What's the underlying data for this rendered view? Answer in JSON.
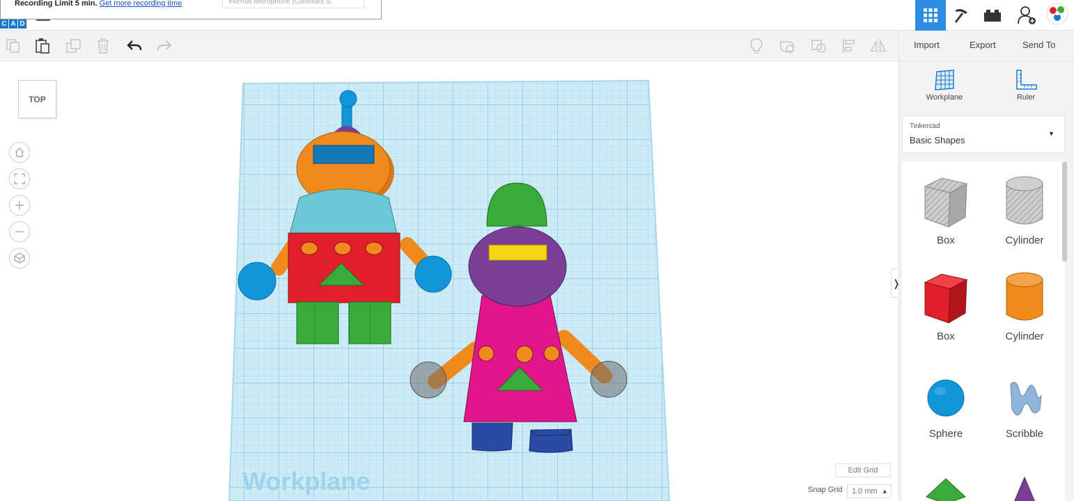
{
  "recording": {
    "limit_text": "Recording Limit 5 min.",
    "link_text": "Get more recording time",
    "mic_select": "Internal Microphone (Conexant S"
  },
  "header": {
    "logo_letters": [
      "C",
      "A",
      "D"
    ],
    "buttons": [
      {
        "name": "grid-view",
        "active": true
      },
      {
        "name": "pickaxe",
        "active": false
      },
      {
        "name": "bricks",
        "active": false
      },
      {
        "name": "add-user",
        "active": false
      },
      {
        "name": "avatar",
        "active": false
      }
    ]
  },
  "toolbar": {
    "actions": {
      "import": "Import",
      "export": "Export",
      "send_to": "Send To"
    }
  },
  "viewcube": {
    "label": "TOP"
  },
  "workplane": {
    "label": "Workplane",
    "grid_color": "#9fd8f0"
  },
  "grid_controls": {
    "edit_grid": "Edit Grid",
    "snap_grid_label": "Snap Grid",
    "snap_grid_value": "1.0 mm"
  },
  "panel": {
    "tools": {
      "workplane": "Workplane",
      "ruler": "Ruler"
    },
    "library": {
      "category": "Tinkercad",
      "selected": "Basic Shapes"
    },
    "shapes": [
      {
        "label": "Box",
        "color": "#bbbbbb",
        "kind": "box-hole"
      },
      {
        "label": "Cylinder",
        "color": "#bbbbbb",
        "kind": "cylinder-hole"
      },
      {
        "label": "Box",
        "color": "#e01f2a",
        "kind": "box"
      },
      {
        "label": "Cylinder",
        "color": "#f08a1c",
        "kind": "cylinder"
      },
      {
        "label": "Sphere",
        "color": "#1196d9",
        "kind": "sphere"
      },
      {
        "label": "Scribble",
        "color": "#8fb6d9",
        "kind": "scribble"
      }
    ]
  },
  "colors": {
    "accent": "#2d8ce6",
    "robot_orange": "#f08a1c",
    "robot_red": "#e01f2a",
    "robot_blue": "#1196d9",
    "robot_green": "#3aaa3a",
    "robot_purple": "#7a3e97",
    "robot_magenta": "#e0168a",
    "robot_yellow": "#f5d615",
    "robot_lightblue": "#6bc8d5",
    "robot_navy": "#2a4aa6"
  }
}
